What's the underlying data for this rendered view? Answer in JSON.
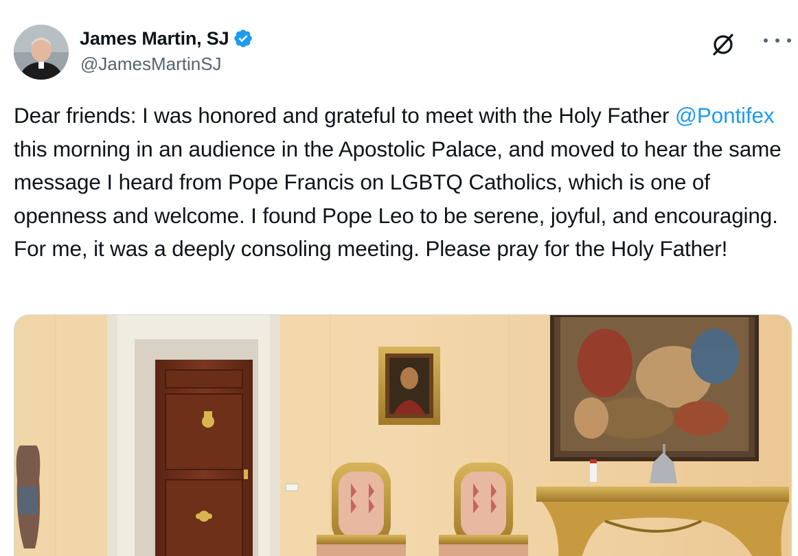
{
  "author": {
    "display_name": "James Martin, SJ",
    "handle": "@JamesMartinSJ",
    "verified": true,
    "avatar_icon": "profile-photo"
  },
  "actions": {
    "grok_icon": "grok-icon",
    "more_icon": "more-options-icon"
  },
  "tweet": {
    "text_before": "Dear friends: I was honored and grateful to meet with the Holy Father ",
    "mention": "@Pontifex",
    "text_after": " this morning in an audience in the Apostolic Palace, and moved to hear the same message I heard from Pope Francis on LGBTQ Catholics, which is one of openness and welcome. I found Pope Leo to be serene, joyful, and encouraging. For me, it was a deeply consoling meeting. Please pray for the Holy Father!"
  },
  "media": {
    "kind": "photo",
    "subject": "palace-room-photo"
  },
  "colors": {
    "accent": "#1d9bf0",
    "text": "#0f1419",
    "secondary": "#536471",
    "border": "#cfd9de"
  }
}
